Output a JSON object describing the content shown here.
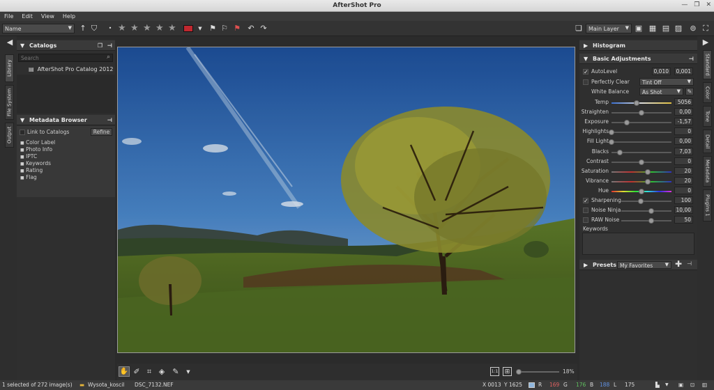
{
  "window": {
    "title": "AfterShot Pro"
  },
  "menu": [
    "File",
    "Edit",
    "View",
    "Help"
  ],
  "toolbar": {
    "sort_value": "Name",
    "layer_value": "Main Layer"
  },
  "left_tabs": [
    "Library",
    "File System",
    "Output"
  ],
  "right_tabs": [
    "Standard",
    "Color",
    "Tone",
    "Detail",
    "Metadata",
    "Plugins 1"
  ],
  "catalogs": {
    "title": "Catalogs",
    "search_placeholder": "Search",
    "items": [
      "AfterShot Pro Catalog 2012"
    ]
  },
  "metadata_browser": {
    "title": "Metadata Browser",
    "link_label": "Link to Catalogs",
    "refine_label": "Refine",
    "items": [
      "Color Label",
      "Photo Info",
      "IPTC",
      "Keywords",
      "Rating",
      "Flag"
    ]
  },
  "histogram": {
    "title": "Histogram"
  },
  "basic": {
    "title": "Basic Adjustments",
    "autolevel": {
      "label": "AutoLevel",
      "v1": "0,010",
      "v2": "0,001"
    },
    "perfectly_clear": {
      "label": "Perfectly Clear",
      "value": "Tint Off"
    },
    "white_balance": {
      "label": "White Balance",
      "value": "As Shot"
    },
    "sliders": [
      {
        "label": "Temp",
        "value": "5056",
        "pos": 0.42
      },
      {
        "label": "Straighten",
        "value": "0,00",
        "pos": 0.5
      },
      {
        "label": "Exposure",
        "value": "-1,57",
        "pos": 0.25
      },
      {
        "label": "Highlights",
        "value": "0",
        "pos": 0.0
      },
      {
        "label": "Fill Light",
        "value": "0,00",
        "pos": 0.0
      },
      {
        "label": "Blacks",
        "value": "7,03",
        "pos": 0.14
      },
      {
        "label": "Contrast",
        "value": "0",
        "pos": 0.5
      },
      {
        "label": "Saturation",
        "value": "20",
        "pos": 0.6
      },
      {
        "label": "Vibrance",
        "value": "20",
        "pos": 0.6
      },
      {
        "label": "Hue",
        "value": "0",
        "pos": 0.5
      }
    ],
    "sharpening": {
      "label": "Sharpening",
      "value": "100",
      "pos": 0.39
    },
    "noise_ninja": {
      "label": "Noise Ninja",
      "value": "10,00",
      "pos": 0.6
    },
    "raw_noise": {
      "label": "RAW Noise",
      "value": "50",
      "pos": 0.6
    },
    "keywords_label": "Keywords"
  },
  "presets": {
    "title": "Presets",
    "value": "My Favorites"
  },
  "zoom": "18%",
  "status": {
    "selection": "1 selected of 272 image(s)",
    "folder": "Wysota_koscil",
    "file": "DSC_7132.NEF",
    "x": "X 0013",
    "y": "Y 1625",
    "r_label": "R",
    "r": "169",
    "g_label": "G",
    "g": "176",
    "b_label": "B",
    "b": "188",
    "l_label": "L",
    "l": "175"
  },
  "colors": {
    "accent_red": "#c0282f",
    "r": "#e06060",
    "g": "#60c060",
    "b": "#6090e0"
  }
}
